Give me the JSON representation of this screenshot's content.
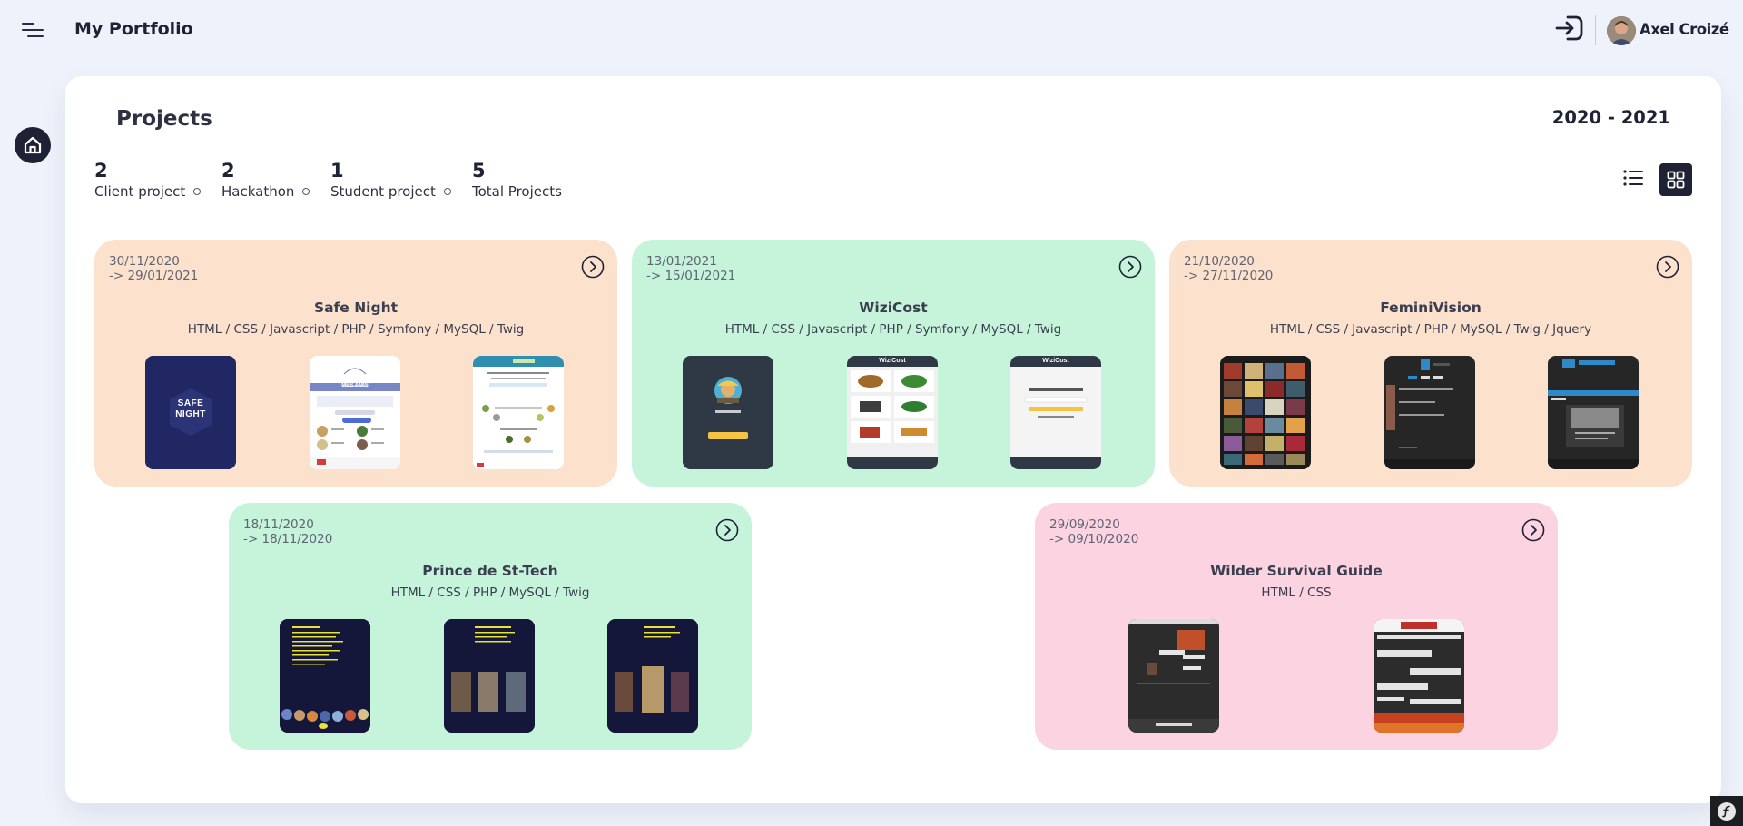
{
  "header": {
    "title": "My Portfolio",
    "user_name": "Axel Croizé"
  },
  "page": {
    "title": "Projects",
    "year_range": "2020 - 2021"
  },
  "stats": [
    {
      "count": "2",
      "label": "Client project"
    },
    {
      "count": "2",
      "label": "Hackathon"
    },
    {
      "count": "1",
      "label": "Student project"
    },
    {
      "count": "5",
      "label": "Total Projects"
    }
  ],
  "projects": [
    {
      "start": "30/11/2020",
      "end": "-> 29/01/2021",
      "title": "Safe Night",
      "tags": "HTML / CSS / Javascript / PHP / Symfony / MySQL / Twig",
      "color": "#fce2cd"
    },
    {
      "start": "13/01/2021",
      "end": "-> 15/01/2021",
      "title": "WiziCost",
      "tags": "HTML / CSS / Javascript / PHP / Symfony / MySQL / Twig",
      "color": "#c6f4db"
    },
    {
      "start": "21/10/2020",
      "end": "-> 27/11/2020",
      "title": "FeminiVision",
      "tags": "HTML / CSS / Javascript / PHP / MySQL / Twig / Jquery",
      "color": "#fce2cd"
    },
    {
      "start": "18/11/2020",
      "end": "-> 18/11/2020",
      "title": "Prince de St-Tech",
      "tags": "HTML / CSS / PHP / MySQL / Twig",
      "color": "#c6f4db"
    },
    {
      "start": "29/09/2020",
      "end": "-> 09/10/2020",
      "title": "Wilder Survival Guide",
      "tags": "HTML / CSS",
      "color": "#fcd3e0"
    }
  ],
  "thumbnails": {
    "safe_night_logo": "SAFE NIGHT",
    "safe_night_screen": "MES AMIS",
    "wizicost_brand": "WiziCost"
  },
  "colors": {
    "dark": "#1f2235",
    "background": "#eef2fa",
    "peach": "#fce2cd",
    "mint": "#c6f4db",
    "pink": "#fcd3e0"
  }
}
